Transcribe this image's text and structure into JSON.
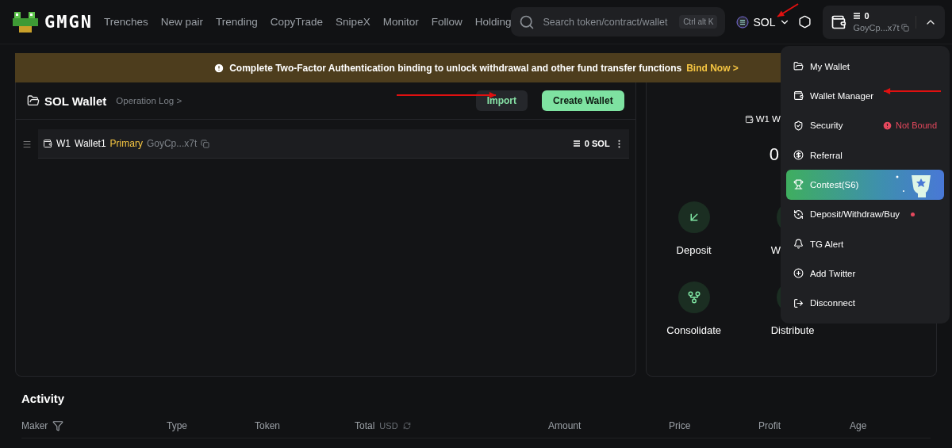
{
  "header": {
    "logo": "GMGN",
    "nav": [
      {
        "label": "Trenches"
      },
      {
        "label": "New pair"
      },
      {
        "label": "Trending"
      },
      {
        "label": "CopyTrade"
      },
      {
        "label": "SnipeX"
      },
      {
        "label": "Monitor"
      },
      {
        "label": "Follow"
      },
      {
        "label": "Holding"
      }
    ],
    "search": {
      "placeholder": "Search token/contract/wallet",
      "shortcut": "Ctrl alt K"
    },
    "chain": "SOL",
    "wallet": {
      "balance": "0",
      "address": "GoyCp...x7t",
      "expanded": true
    }
  },
  "banner": {
    "text": "Complete Two-Factor Authentication binding to unlock withdrawal and other fund transfer functions",
    "link": "Bind Now >"
  },
  "wallet_panel": {
    "title": "SOL Wallet",
    "log_link": "Operation Log >",
    "buttons": [
      {
        "label": "Import",
        "kind": "secondary"
      },
      {
        "label": "Create Wallet",
        "kind": "primary"
      }
    ],
    "wallets": [
      {
        "index": "W1",
        "name": "Wallet1",
        "tag": "Primary",
        "address": "GoyCp...x7t",
        "balance": "0 SOL"
      }
    ]
  },
  "detail_panel": {
    "wallet_label": "W1 W",
    "balance": "0",
    "actions": [
      {
        "label": "Deposit",
        "kind": "deposit"
      },
      {
        "label": "W",
        "kind": "withdraw"
      },
      {
        "label": "Consolidate",
        "kind": "consolidate"
      },
      {
        "label": "Distribute",
        "kind": "distribute"
      }
    ]
  },
  "menu": [
    {
      "label": "My Wallet",
      "kind": "wallet"
    },
    {
      "label": "Wallet Manager",
      "kind": "manager"
    },
    {
      "label": "Security",
      "kind": "security",
      "status": "Not Bound"
    },
    {
      "label": "Referral",
      "kind": "referral"
    },
    {
      "label": "Contest(S6)",
      "kind": "contest"
    },
    {
      "label": "Deposit/Withdraw/Buy",
      "kind": "deposit",
      "dot": true
    },
    {
      "label": "TG Alert",
      "kind": "alert"
    },
    {
      "label": "Add Twitter",
      "kind": "add"
    },
    {
      "label": "Disconnect",
      "kind": "logout"
    }
  ],
  "activity": {
    "title": "Activity",
    "columns": [
      {
        "label": "Maker",
        "kind": "filter"
      },
      {
        "label": "Type"
      },
      {
        "label": "Token"
      },
      {
        "label": "Total",
        "unit": "USD",
        "kind": "unit"
      },
      {
        "label": "Amount"
      },
      {
        "label": "Price"
      },
      {
        "label": "Profit"
      },
      {
        "label": "Age"
      }
    ]
  }
}
